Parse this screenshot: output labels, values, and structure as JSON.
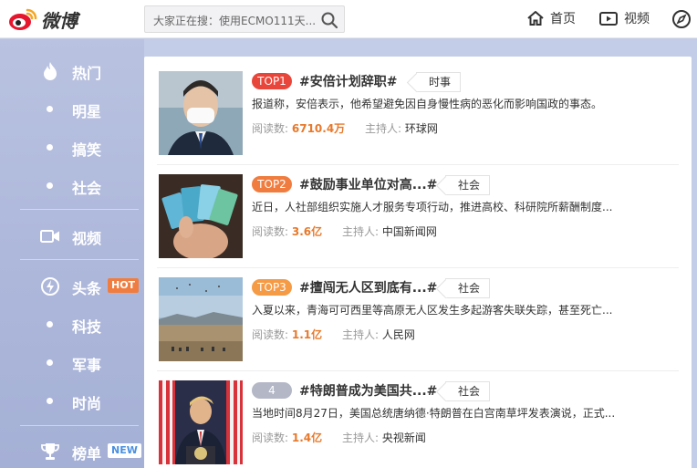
{
  "header": {
    "logo_text": "微博",
    "search_placeholder": "大家正在搜：使用ECMO111天...",
    "nav": [
      {
        "label": "首页",
        "icon": "home-icon"
      },
      {
        "label": "视频",
        "icon": "video-icon"
      }
    ]
  },
  "sidebar": {
    "items": [
      {
        "label": "热门",
        "icon": "fire-icon"
      },
      {
        "label": "明星",
        "icon": "dot"
      },
      {
        "label": "搞笑",
        "icon": "dot"
      },
      {
        "label": "社会",
        "icon": "dot"
      },
      {
        "label": "视频",
        "icon": "video-icon"
      },
      {
        "label": "头条",
        "icon": "lightning-icon",
        "badge": "HOT"
      },
      {
        "label": "科技",
        "icon": "dot"
      },
      {
        "label": "军事",
        "icon": "dot"
      },
      {
        "label": "时尚",
        "icon": "dot"
      },
      {
        "label": "榜单",
        "icon": "trophy-icon",
        "badge": "NEW"
      }
    ]
  },
  "topics": [
    {
      "rank": "TOP1",
      "rank_color": "#e8463b",
      "title": "#安倍计划辞职#",
      "tag": "时事",
      "desc": "报道称，安倍表示，他希望避免因自身慢性病的恶化而影响国政的事态。",
      "reads_label": "阅读数:",
      "reads": "6710.4万",
      "host_label": "主持人:",
      "host": "环球网"
    },
    {
      "rank": "TOP2",
      "rank_color": "#f07d3f",
      "title": "#鼓励事业单位对高...#",
      "tag": "社会",
      "desc": "近日，人社部组织实施人才服务专项行动，推进高校、科研院所薪酬制度...",
      "reads_label": "阅读数:",
      "reads": "3.6亿",
      "host_label": "主持人:",
      "host": "中国新闻网"
    },
    {
      "rank": "TOP3",
      "rank_color": "#f59a45",
      "title": "#擅闯无人区到底有...#",
      "tag": "社会",
      "desc": "入夏以来，青海可可西里等高原无人区发生多起游客失联失踪，甚至死亡...",
      "reads_label": "阅读数:",
      "reads": "1.1亿",
      "host_label": "主持人:",
      "host": "人民网"
    },
    {
      "rank": "4",
      "rank_color": "#b3b7c6",
      "title": "#特朗普成为美国共...#",
      "tag": "社会",
      "desc": "当地时间8月27日，美国总统唐纳德·特朗普在白宫南草坪发表演说，正式...",
      "reads_label": "阅读数:",
      "reads": "1.4亿",
      "host_label": "主持人:",
      "host": "央视新闻"
    }
  ]
}
